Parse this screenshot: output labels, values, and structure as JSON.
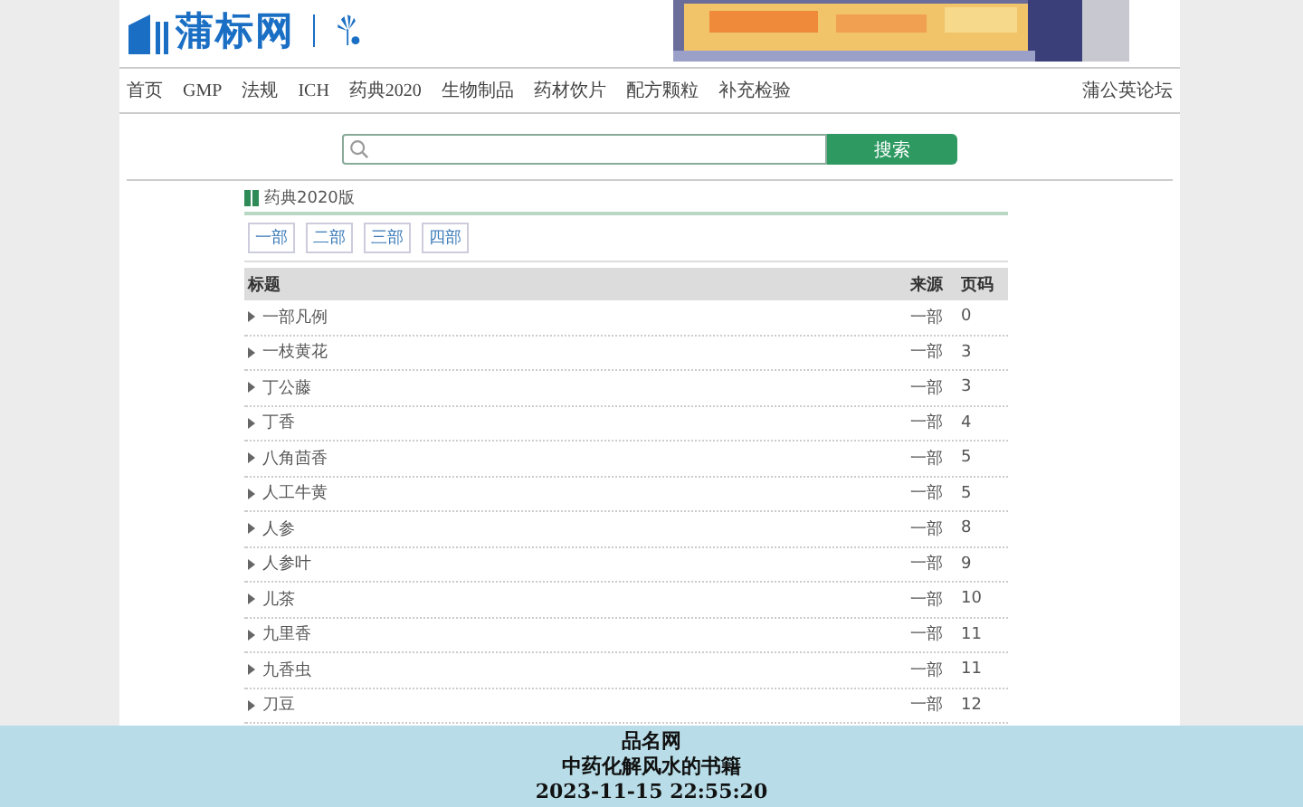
{
  "header": {
    "logo_text": "蒲标网"
  },
  "nav": {
    "items": [
      "首页",
      "GMP",
      "法规",
      "ICH",
      "药典2020",
      "生物制品",
      "药材饮片",
      "配方颗粒",
      "补充检验"
    ],
    "right_link": "蒲公英论坛"
  },
  "search": {
    "button": "搜索"
  },
  "section": {
    "title": "药典2020版",
    "tabs": [
      "一部",
      "二部",
      "三部",
      "四部"
    ]
  },
  "table": {
    "columns": [
      "标题",
      "来源",
      "页码"
    ],
    "rows": [
      {
        "title": "一部凡例",
        "source": "一部",
        "page": "0"
      },
      {
        "title": "一枝黄花",
        "source": "一部",
        "page": "3"
      },
      {
        "title": "丁公藤",
        "source": "一部",
        "page": "3"
      },
      {
        "title": "丁香",
        "source": "一部",
        "page": "4"
      },
      {
        "title": "八角茴香",
        "source": "一部",
        "page": "5"
      },
      {
        "title": "人工牛黄",
        "source": "一部",
        "page": "5"
      },
      {
        "title": "人参",
        "source": "一部",
        "page": "8"
      },
      {
        "title": "人参叶",
        "source": "一部",
        "page": "9"
      },
      {
        "title": "儿茶",
        "source": "一部",
        "page": "10"
      },
      {
        "title": "九里香",
        "source": "一部",
        "page": "11"
      },
      {
        "title": "九香虫",
        "source": "一部",
        "page": "11"
      },
      {
        "title": "刀豆",
        "source": "一部",
        "page": "12"
      }
    ]
  },
  "caption_overlay": {
    "lines": [
      "品名网",
      "中药化解风水的书籍",
      "2023-11-15 22:55:20"
    ]
  }
}
